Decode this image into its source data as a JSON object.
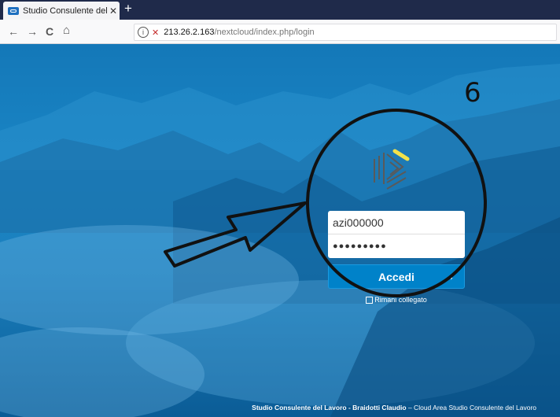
{
  "browser": {
    "tab_title": "Studio Consulente del Lavoro -",
    "tab_close": "✕",
    "new_tab": "+",
    "nav_back": "←",
    "nav_forward": "→",
    "nav_reload": "C",
    "nav_home": "⌂",
    "url_info": "i",
    "url_lock": "✕",
    "url_host": "213.26.2.163",
    "url_path": "/nextcloud/index.php/login"
  },
  "login": {
    "username_value": "azi000000",
    "password_value": "●●●●●●●●●",
    "submit_label": "Accedi",
    "submit_arrow": "→",
    "remember_label": "Rimani collegato"
  },
  "footer": {
    "bold_text": "Studio Consulente del Lavoro - Braidotti Claudio",
    "rest_text": " – Cloud Area Studio Consulente del Lavoro"
  },
  "annotation": {
    "step_number": "6"
  },
  "colors": {
    "accent": "#0082c9",
    "background": "#1a86c6"
  }
}
